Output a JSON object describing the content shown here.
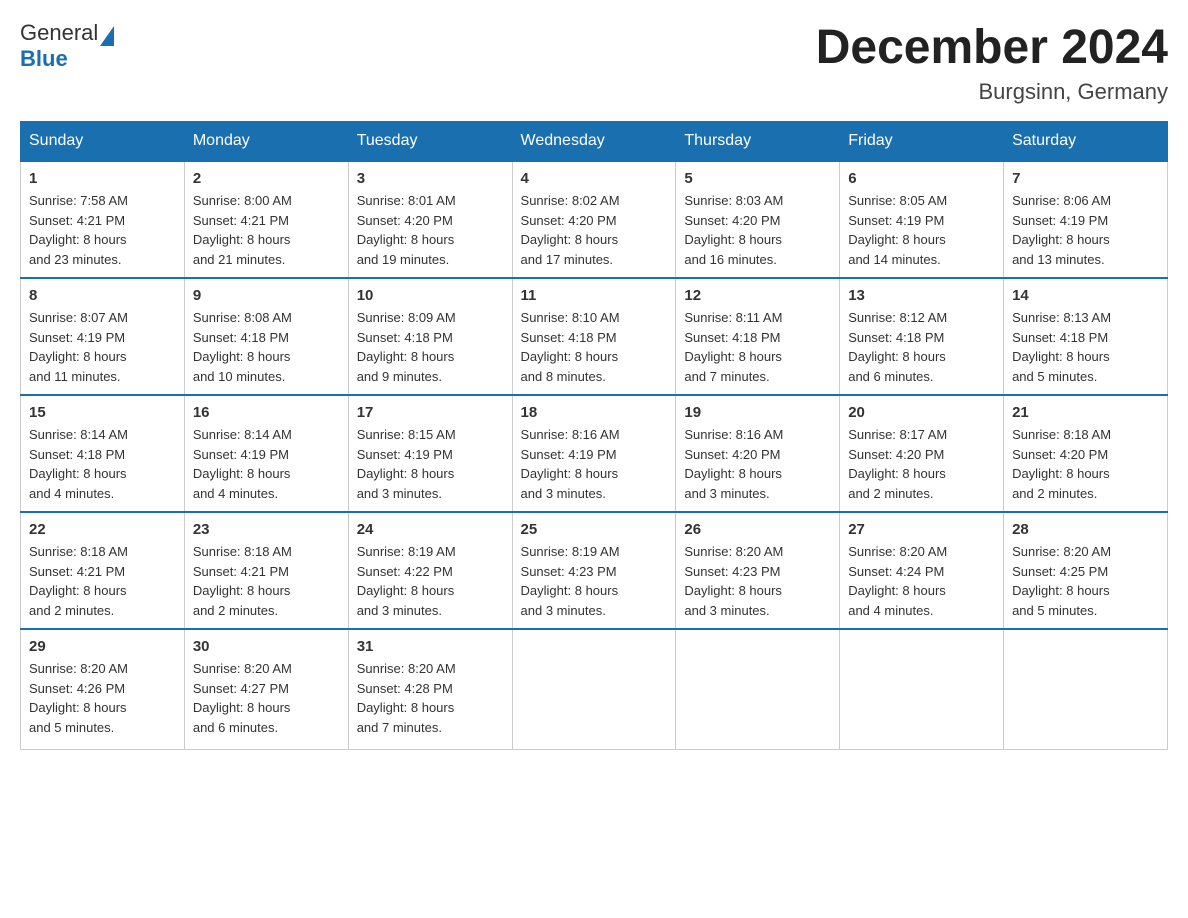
{
  "logo": {
    "text_general": "General",
    "text_blue": "Blue"
  },
  "title": {
    "month": "December 2024",
    "location": "Burgsinn, Germany"
  },
  "weekdays": [
    "Sunday",
    "Monday",
    "Tuesday",
    "Wednesday",
    "Thursday",
    "Friday",
    "Saturday"
  ],
  "weeks": [
    [
      {
        "day": "1",
        "sunrise": "7:58 AM",
        "sunset": "4:21 PM",
        "daylight": "8 hours and 23 minutes."
      },
      {
        "day": "2",
        "sunrise": "8:00 AM",
        "sunset": "4:21 PM",
        "daylight": "8 hours and 21 minutes."
      },
      {
        "day": "3",
        "sunrise": "8:01 AM",
        "sunset": "4:20 PM",
        "daylight": "8 hours and 19 minutes."
      },
      {
        "day": "4",
        "sunrise": "8:02 AM",
        "sunset": "4:20 PM",
        "daylight": "8 hours and 17 minutes."
      },
      {
        "day": "5",
        "sunrise": "8:03 AM",
        "sunset": "4:20 PM",
        "daylight": "8 hours and 16 minutes."
      },
      {
        "day": "6",
        "sunrise": "8:05 AM",
        "sunset": "4:19 PM",
        "daylight": "8 hours and 14 minutes."
      },
      {
        "day": "7",
        "sunrise": "8:06 AM",
        "sunset": "4:19 PM",
        "daylight": "8 hours and 13 minutes."
      }
    ],
    [
      {
        "day": "8",
        "sunrise": "8:07 AM",
        "sunset": "4:19 PM",
        "daylight": "8 hours and 11 minutes."
      },
      {
        "day": "9",
        "sunrise": "8:08 AM",
        "sunset": "4:18 PM",
        "daylight": "8 hours and 10 minutes."
      },
      {
        "day": "10",
        "sunrise": "8:09 AM",
        "sunset": "4:18 PM",
        "daylight": "8 hours and 9 minutes."
      },
      {
        "day": "11",
        "sunrise": "8:10 AM",
        "sunset": "4:18 PM",
        "daylight": "8 hours and 8 minutes."
      },
      {
        "day": "12",
        "sunrise": "8:11 AM",
        "sunset": "4:18 PM",
        "daylight": "8 hours and 7 minutes."
      },
      {
        "day": "13",
        "sunrise": "8:12 AM",
        "sunset": "4:18 PM",
        "daylight": "8 hours and 6 minutes."
      },
      {
        "day": "14",
        "sunrise": "8:13 AM",
        "sunset": "4:18 PM",
        "daylight": "8 hours and 5 minutes."
      }
    ],
    [
      {
        "day": "15",
        "sunrise": "8:14 AM",
        "sunset": "4:18 PM",
        "daylight": "8 hours and 4 minutes."
      },
      {
        "day": "16",
        "sunrise": "8:14 AM",
        "sunset": "4:19 PM",
        "daylight": "8 hours and 4 minutes."
      },
      {
        "day": "17",
        "sunrise": "8:15 AM",
        "sunset": "4:19 PM",
        "daylight": "8 hours and 3 minutes."
      },
      {
        "day": "18",
        "sunrise": "8:16 AM",
        "sunset": "4:19 PM",
        "daylight": "8 hours and 3 minutes."
      },
      {
        "day": "19",
        "sunrise": "8:16 AM",
        "sunset": "4:20 PM",
        "daylight": "8 hours and 3 minutes."
      },
      {
        "day": "20",
        "sunrise": "8:17 AM",
        "sunset": "4:20 PM",
        "daylight": "8 hours and 2 minutes."
      },
      {
        "day": "21",
        "sunrise": "8:18 AM",
        "sunset": "4:20 PM",
        "daylight": "8 hours and 2 minutes."
      }
    ],
    [
      {
        "day": "22",
        "sunrise": "8:18 AM",
        "sunset": "4:21 PM",
        "daylight": "8 hours and 2 minutes."
      },
      {
        "day": "23",
        "sunrise": "8:18 AM",
        "sunset": "4:21 PM",
        "daylight": "8 hours and 2 minutes."
      },
      {
        "day": "24",
        "sunrise": "8:19 AM",
        "sunset": "4:22 PM",
        "daylight": "8 hours and 3 minutes."
      },
      {
        "day": "25",
        "sunrise": "8:19 AM",
        "sunset": "4:23 PM",
        "daylight": "8 hours and 3 minutes."
      },
      {
        "day": "26",
        "sunrise": "8:20 AM",
        "sunset": "4:23 PM",
        "daylight": "8 hours and 3 minutes."
      },
      {
        "day": "27",
        "sunrise": "8:20 AM",
        "sunset": "4:24 PM",
        "daylight": "8 hours and 4 minutes."
      },
      {
        "day": "28",
        "sunrise": "8:20 AM",
        "sunset": "4:25 PM",
        "daylight": "8 hours and 5 minutes."
      }
    ],
    [
      {
        "day": "29",
        "sunrise": "8:20 AM",
        "sunset": "4:26 PM",
        "daylight": "8 hours and 5 minutes."
      },
      {
        "day": "30",
        "sunrise": "8:20 AM",
        "sunset": "4:27 PM",
        "daylight": "8 hours and 6 minutes."
      },
      {
        "day": "31",
        "sunrise": "8:20 AM",
        "sunset": "4:28 PM",
        "daylight": "8 hours and 7 minutes."
      },
      null,
      null,
      null,
      null
    ]
  ],
  "labels": {
    "sunrise": "Sunrise:",
    "sunset": "Sunset:",
    "daylight": "Daylight:"
  }
}
